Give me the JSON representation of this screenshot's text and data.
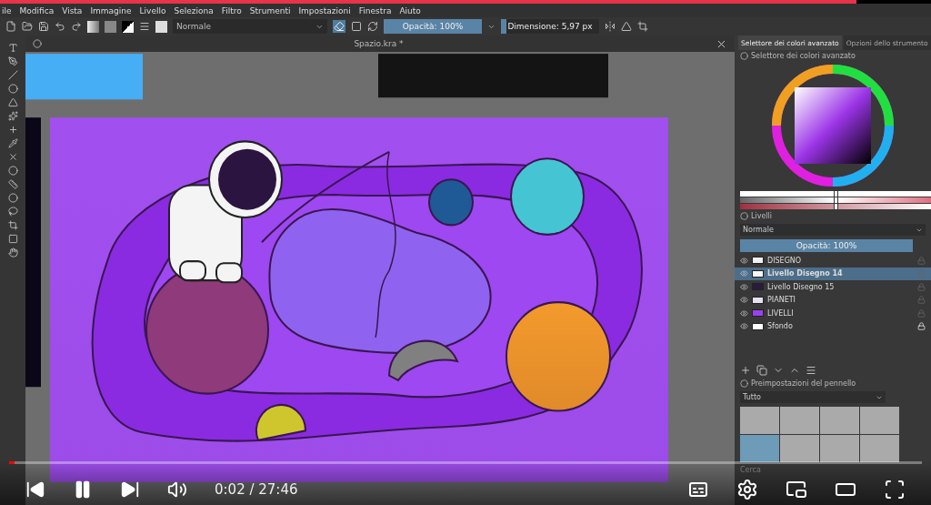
{
  "menu": [
    "ile",
    "Modifica",
    "Vista",
    "Immagine",
    "Livello",
    "Seleziona",
    "Filtro",
    "Strumenti",
    "Impostazioni",
    "Finestra",
    "Aiuto"
  ],
  "toolbar": {
    "blend_mode": "Normale",
    "opacity": {
      "text": "Opacità: 100%",
      "level": 1
    },
    "size": {
      "text": "Dimensione: 5,97 px",
      "level": 0.06
    }
  },
  "document": {
    "title": "Spazio.kra *"
  },
  "dock": {
    "tabs": [
      {
        "label": "Selettore dei colori avanzato",
        "selected": true
      },
      {
        "label": "Opzioni dello strumento",
        "selected": false
      }
    ],
    "color_panel": {
      "title": "Selettore dei colori avanzato",
      "sliders": [
        {
          "level": 0.5
        },
        {
          "level": 0.5
        },
        {
          "level": 0.5
        }
      ]
    },
    "layers_panel": {
      "title": "Livelli",
      "blend_mode": "Normale",
      "opacity": {
        "text": "Opacità:  100%",
        "level": 1
      },
      "layers": [
        {
          "name": "DISEGNO",
          "selected": false,
          "locked": false,
          "color": "#f0f0f0"
        },
        {
          "name": "Livello Disegno 14",
          "selected": true,
          "locked": false,
          "color": "#f7f7f7"
        },
        {
          "name": "Livello Disegno 15",
          "selected": false,
          "locked": false,
          "color": "#2a1a40"
        },
        {
          "name": "PIANETI",
          "selected": false,
          "locked": false,
          "color": "#e8e0f0"
        },
        {
          "name": "LIVELLI",
          "selected": false,
          "locked": false,
          "color": "#9b40f0"
        },
        {
          "name": "Sfondo",
          "selected": false,
          "locked": true,
          "color": "#ffffff"
        }
      ]
    },
    "brush_panel": {
      "title": "Preimpostazioni del pennello",
      "filter": "Tutto",
      "search_placeholder": "Cerca"
    }
  },
  "player": {
    "time": "0:02 / 27:46",
    "progress": {
      "level": 0.006
    }
  }
}
